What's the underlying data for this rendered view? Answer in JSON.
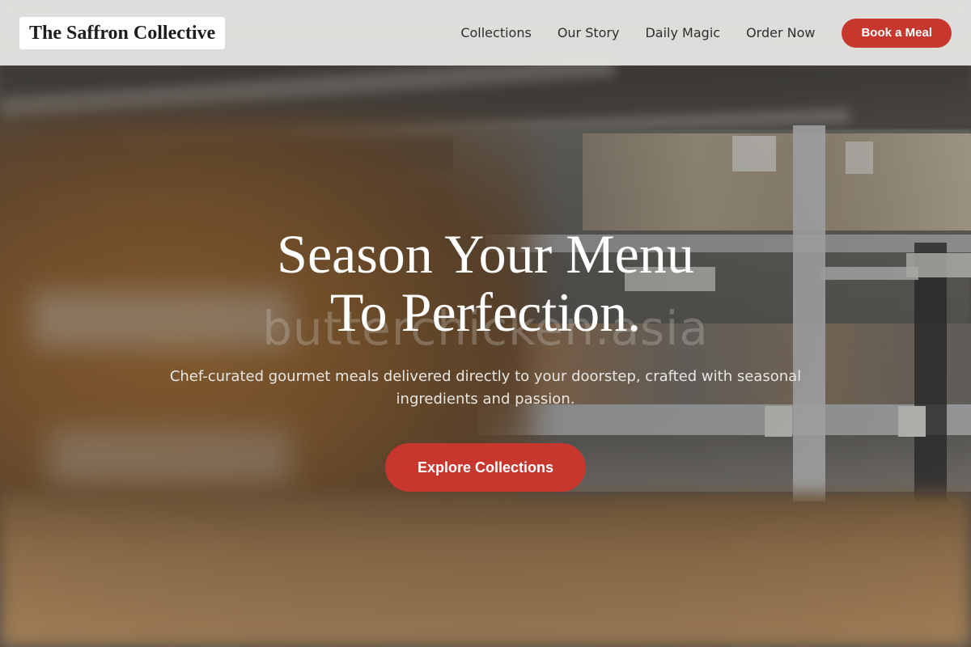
{
  "header": {
    "logo": "The Saffron Collective",
    "nav": [
      {
        "label": "Collections"
      },
      {
        "label": "Our Story"
      },
      {
        "label": "Daily Magic"
      },
      {
        "label": "Order Now"
      }
    ],
    "cta_label": "Book a Meal"
  },
  "hero": {
    "title_line1": "Season Your Menu",
    "title_line2": "To Perfection.",
    "watermark": "butterchicken.asia",
    "subtitle": "Chef-curated gourmet meals delivered directly to your doorstep, crafted with seasonal ingredients and passion.",
    "button_label": "Explore Collections"
  },
  "colors": {
    "accent": "#c7372d",
    "header_bg": "#e8e8e6",
    "hero_text": "#ffffff"
  }
}
